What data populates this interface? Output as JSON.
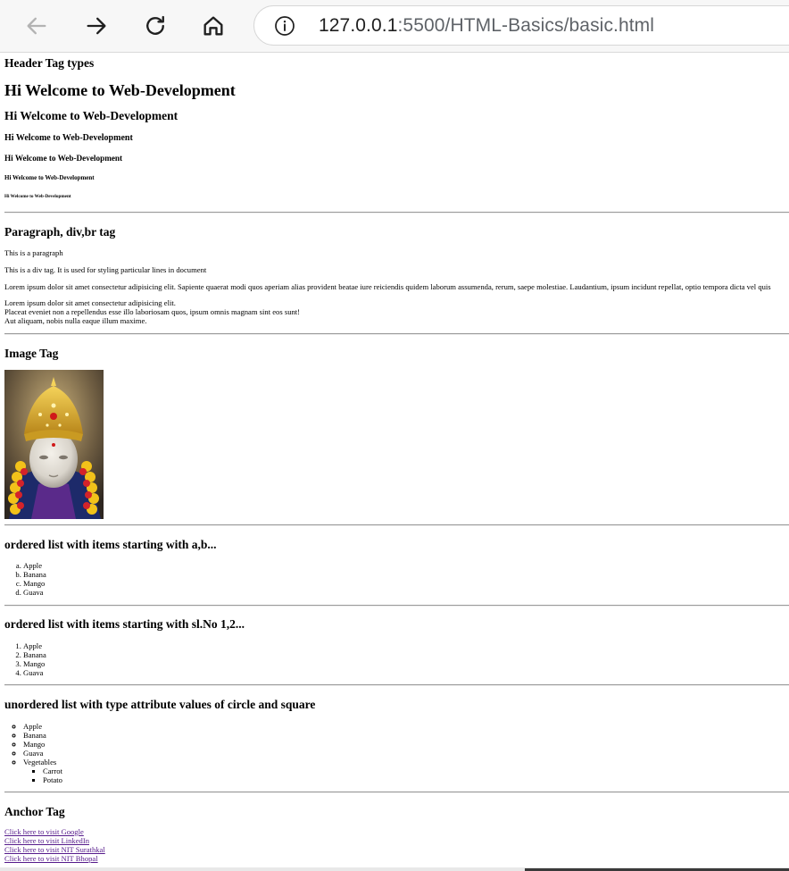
{
  "browser": {
    "url_host": "127.0.0.1",
    "url_path": ":5500/HTML-Basics/basic.html"
  },
  "headers_section": {
    "title": "Header Tag types",
    "h1": "Hi Welcome to Web-Development",
    "h2": "Hi Welcome to Web-Development",
    "h3": "Hi Welcome to Web-Development",
    "h4": "Hi Welcome to Web-Development",
    "h5": "Hi Welcome to Web-Development",
    "h6": "Hi Welcome to Web-Development"
  },
  "paragraph_section": {
    "title": "Paragraph, div,br tag",
    "paragraph": "This is a paragraph",
    "div_text": "This is a div tag. It is used for styling particular lines in document",
    "lorem_long": "Lorem ipsum dolor sit amet consectetur adipisicing elit. Sapiente quaerat modi quos aperiam alias provident beatae iure reiciendis quidem laborum assumenda, rerum, saepe molestiae. Laudantium, ipsum incidunt repellat, optio tempora dicta vel quis",
    "lorem_lines": [
      "Lorem ipsum dolor sit amet consectetur adipisicing elit.",
      "Placeat eveniet non a repellendus esse illo laboriosam quos, ipsum omnis magnam sint eos sunt!",
      "Aut aliquam, nobis nulla eaque illum maxime."
    ]
  },
  "image_section": {
    "title": "Image Tag"
  },
  "ordered_alpha_section": {
    "title": "ordered list with items starting with a,b...",
    "items": [
      "Apple",
      "Banana",
      "Mango",
      "Guava"
    ]
  },
  "ordered_num_section": {
    "title": "ordered list with items starting with sl.No 1,2...",
    "items": [
      "Apple",
      "Banana",
      "Mango",
      "Guava"
    ]
  },
  "unordered_section": {
    "title": "unordered list with type attribute values of circle and square",
    "items": [
      "Apple",
      "Banana",
      "Mango",
      "Guava",
      "Vegetables"
    ],
    "sub_items": [
      "Carrot",
      "Potato"
    ]
  },
  "anchor_section": {
    "title": "Anchor Tag",
    "links": [
      "Click here to visit Google",
      "Click here to visit LinkedIn",
      "Click here to visit NIT Surathkal",
      "Click here to visit NIT Bhopal"
    ]
  }
}
